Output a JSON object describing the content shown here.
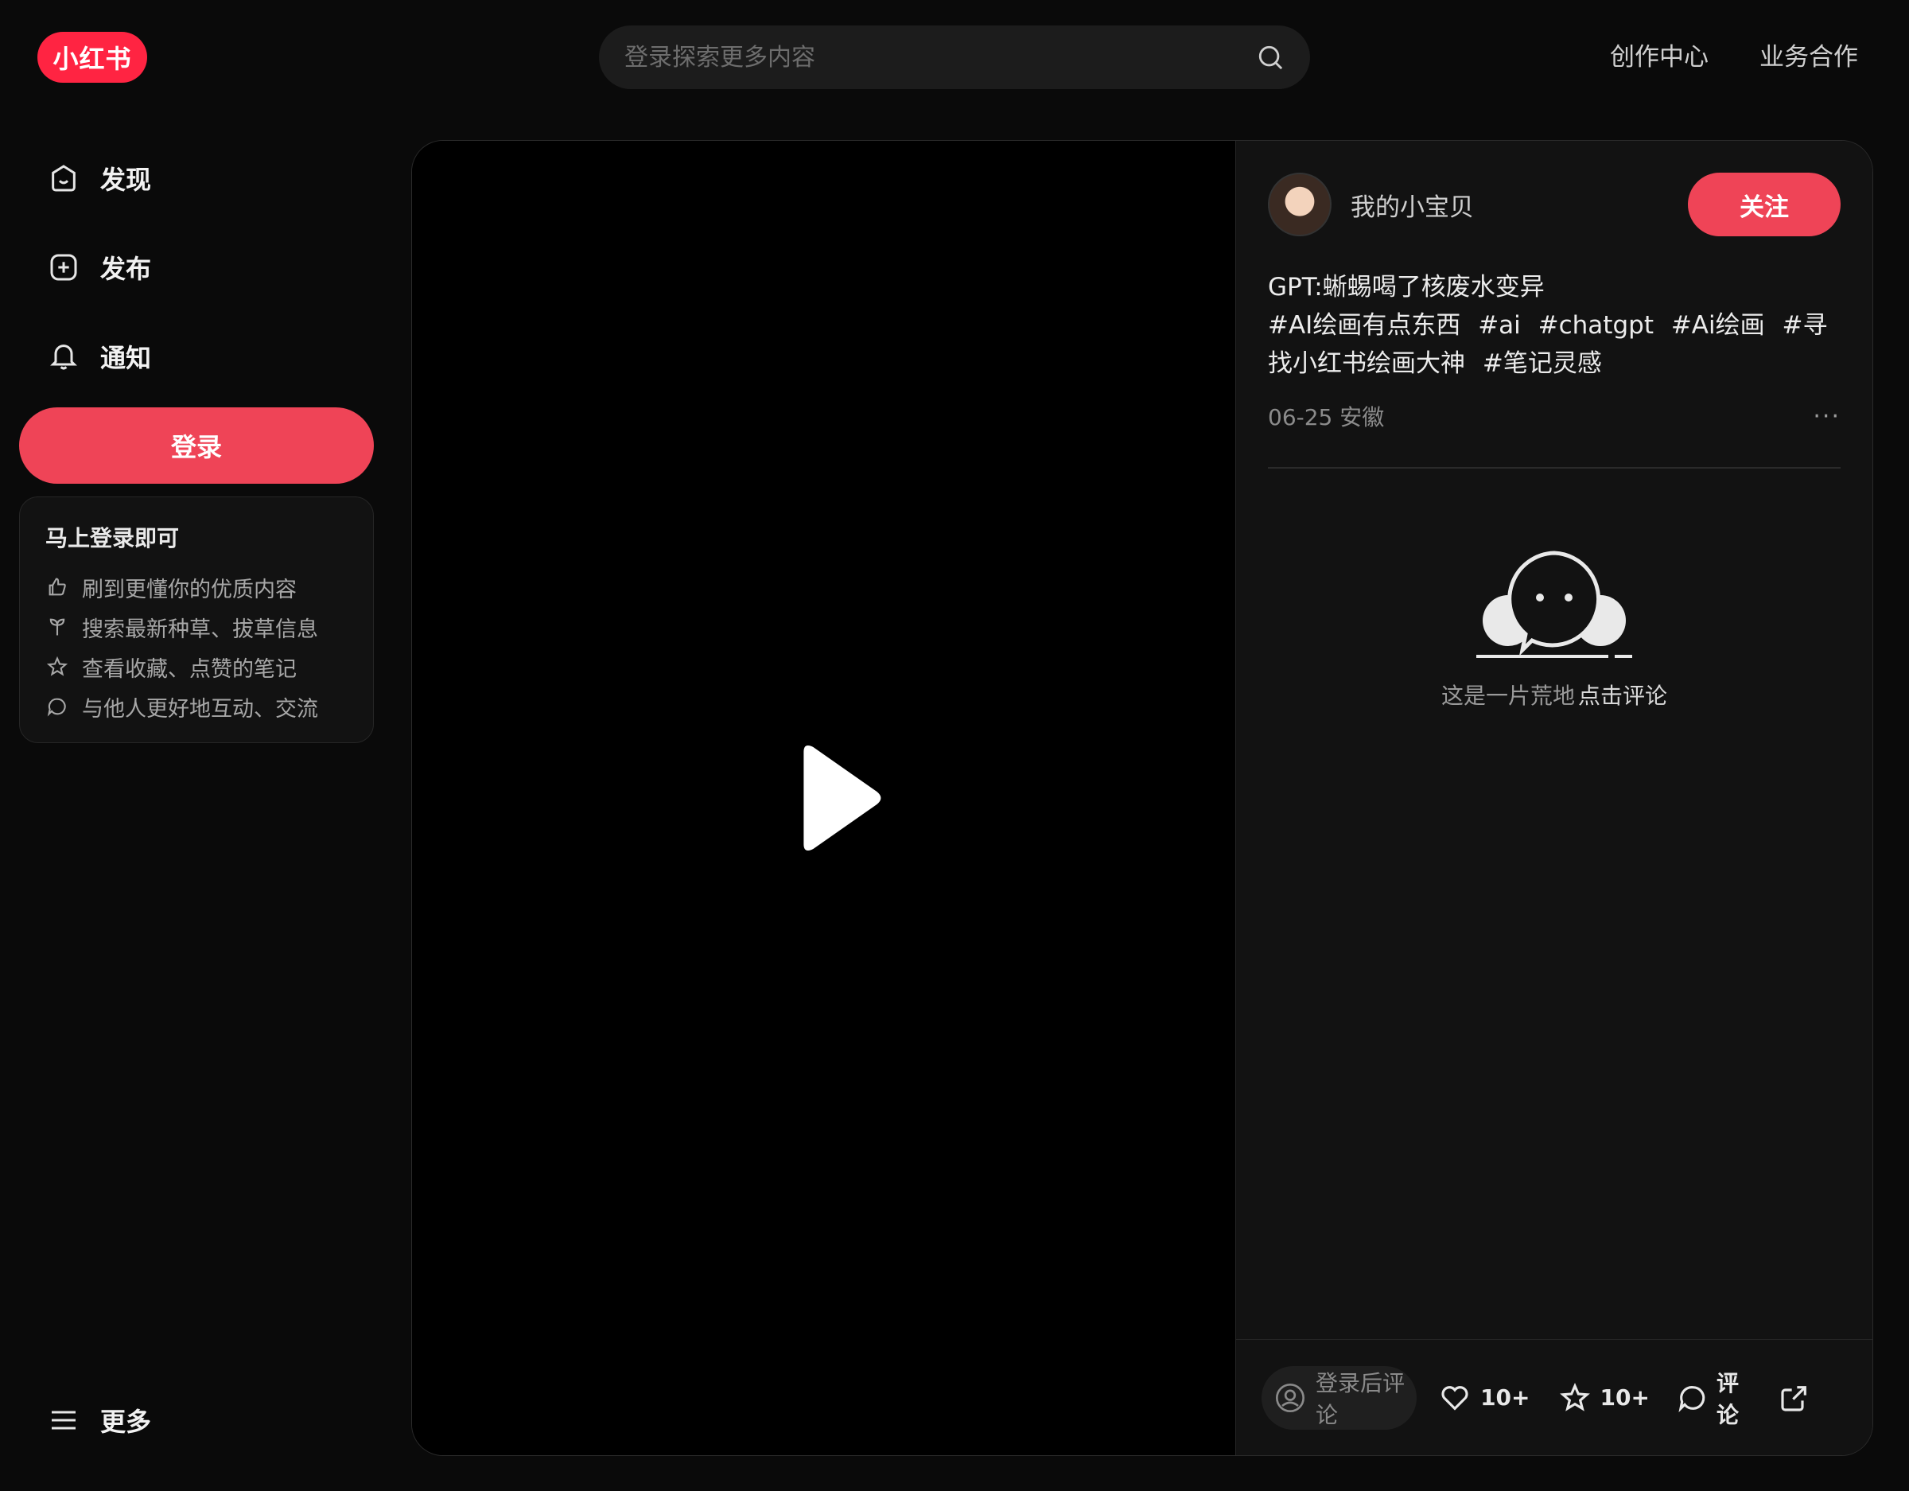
{
  "header": {
    "logo_text": "小红书",
    "search_placeholder": "登录探索更多内容",
    "links": [
      "创作中心",
      "业务合作"
    ]
  },
  "sidebar": {
    "nav": [
      {
        "label": "发现",
        "icon": "home-icon"
      },
      {
        "label": "发布",
        "icon": "plus-square-icon"
      },
      {
        "label": "通知",
        "icon": "bell-icon"
      }
    ],
    "login_label": "登录",
    "login_card": {
      "title": "马上登录即可",
      "items": [
        {
          "text": "刷到更懂你的优质内容",
          "icon": "thumbs-up-icon"
        },
        {
          "text": "搜索最新种草、拔草信息",
          "icon": "sprout-icon"
        },
        {
          "text": "查看收藏、点赞的笔记",
          "icon": "star-icon"
        },
        {
          "text": "与他人更好地互动、交流",
          "icon": "chat-bubble-icon"
        }
      ]
    },
    "more_label": "更多"
  },
  "note": {
    "author_name": "我的小宝贝",
    "follow_label": "关注",
    "title": "GPT:蜥蜴喝了核废水变异",
    "tags": [
      "#AI绘画有点东西",
      "#ai",
      "#chatgpt",
      "#Ai绘画",
      "#寻找小红书绘画大神",
      "#笔记灵感"
    ],
    "date_location": "06-25 安徽",
    "more_dots": "···",
    "empty_text": "这是一片荒地",
    "empty_link": "点击评论"
  },
  "actions": {
    "comment_placeholder": "登录后评论",
    "like_count": "10+",
    "collect_count": "10+",
    "comment_label": "评论"
  },
  "colors": {
    "accent": "#ef4457",
    "background": "#0a0a0a",
    "panel": "#121212"
  }
}
